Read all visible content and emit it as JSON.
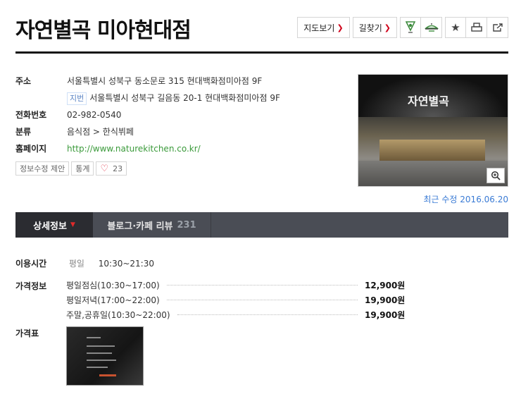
{
  "title": "자연별곡 미아현대점",
  "top_buttons": {
    "map": "지도보기",
    "directions": "길찾기",
    "arrow": "›"
  },
  "info": {
    "address_label": "주소",
    "address": "서울특별시 성북구 동소문로 315 현대백화점미아점 9F",
    "jibun_badge": "지번",
    "jibun_address": "서울특별시 성북구 길음동 20-1 현대백화점미아점 9F",
    "phone_label": "전화번호",
    "phone": "02-982-0540",
    "category_label": "분류",
    "category": "음식점 > 한식뷔페",
    "homepage_label": "홈페이지",
    "homepage": "http://www.naturekitchen.co.kr/"
  },
  "mini_buttons": {
    "suggest": "정보수정 제안",
    "stats": "통계",
    "likes": "23"
  },
  "photo": {
    "sign_text": "자연별곡"
  },
  "updated": "최근 수정 2016.06.20",
  "tabs": [
    {
      "label": "상세정보",
      "active": true
    },
    {
      "label": "블로그·카페 리뷰",
      "count": "231"
    }
  ],
  "details": {
    "hours_label": "이용시간",
    "hours_day": "평일",
    "hours_time": "10:30~21:30",
    "price_label": "가격정보",
    "prices": [
      {
        "name": "평일점심(10:30~17:00)",
        "value": "12,900원"
      },
      {
        "name": "평일저녁(17:00~22:00)",
        "value": "19,900원"
      },
      {
        "name": "주말,공휴일(10:30~22:00)",
        "value": "19,900원"
      }
    ],
    "menu_label": "가격표"
  },
  "colors": {
    "accent_red": "#d0021b",
    "link_green": "#3a9a3a",
    "tab_bar": "#4a4d55",
    "updated_blue": "#3a7bd5"
  },
  "icons": [
    "chevron-right-icon",
    "pin-icon",
    "bowl-icon",
    "star-icon",
    "print-icon",
    "share-icon",
    "heart-icon",
    "zoom-icon",
    "caret-down-icon"
  ]
}
